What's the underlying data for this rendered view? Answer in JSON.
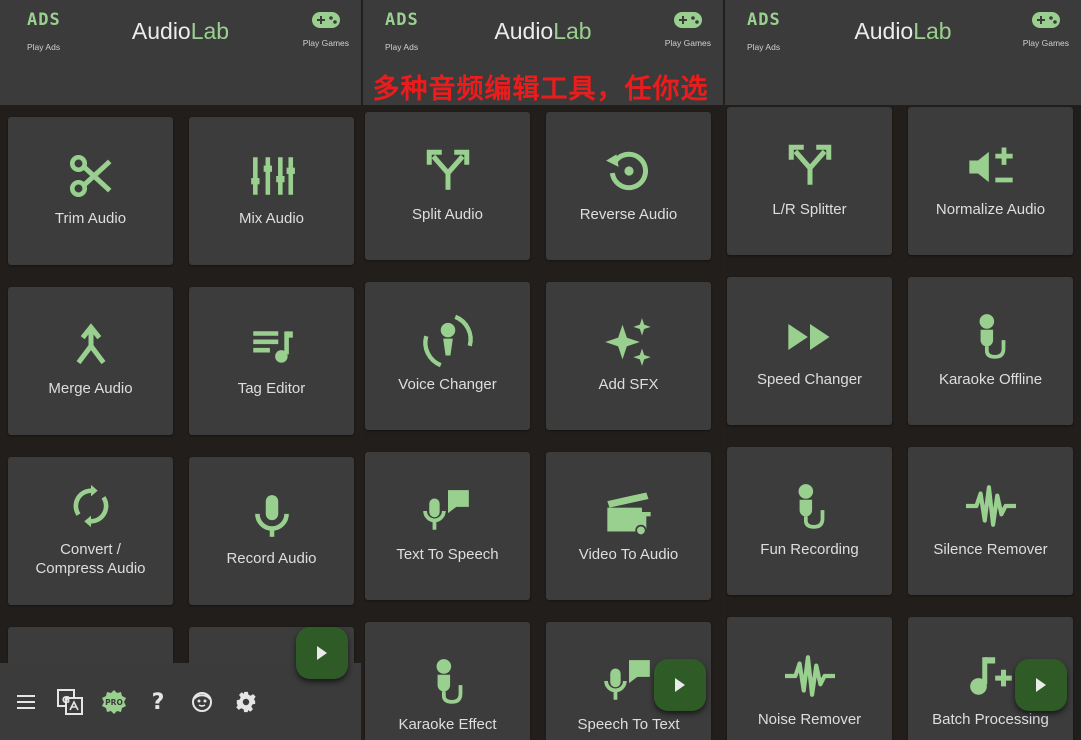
{
  "app": {
    "name_part1": "Audio",
    "name_part2": "Lab"
  },
  "header": {
    "ads_glyph": "ADS",
    "play_ads": "Play Ads",
    "play_games": "Play Games"
  },
  "banner": "多种音频编辑工具，任你选",
  "tiles": {
    "trim": "Trim Audio",
    "mix": "Mix Audio",
    "merge": "Merge Audio",
    "tag": "Tag Editor",
    "convert": "Convert / Compress Audio",
    "record": "Record Audio",
    "split": "Split Audio",
    "reverse": "Reverse Audio",
    "voice": "Voice Changer",
    "sfx": "Add SFX",
    "tts": "Text To Speech",
    "v2a": "Video To Audio",
    "karaoke_effect": "Karaoke Effect",
    "stt": "Speech To Text",
    "lr": "L/R Splitter",
    "normalize": "Normalize Audio",
    "speed": "Speed Changer",
    "karaoke_offline": "Karaoke Offline",
    "fun": "Fun Recording",
    "silence": "Silence Remover",
    "noise": "Noise Remover",
    "batch": "Batch Processing"
  },
  "bottom_bar": {
    "pro_badge": "PRO",
    "help_glyph": "?"
  },
  "icons": [
    "menu-icon",
    "translate-icon",
    "pro-icon",
    "help-icon",
    "face-icon",
    "settings-icon",
    "play-icon",
    "gamepad-icon"
  ],
  "colors": {
    "accent": "#9ad08f",
    "tile_bg": "#3c3c3c",
    "bar_bg": "#3b3b3b",
    "banner_text": "#ec1c1c",
    "fab_bg": "#2f5c26"
  }
}
